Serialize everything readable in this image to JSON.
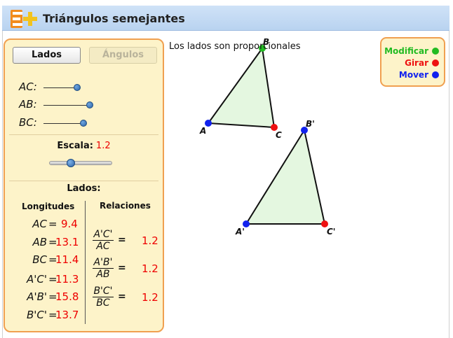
{
  "header": {
    "title": "Triángulos semejantes",
    "logo": "plus-logo-icon"
  },
  "tabs": {
    "lados": "Lados",
    "angulos": "Ángulos"
  },
  "sliders": [
    {
      "label": "AC",
      "value": 9.4
    },
    {
      "label": "AB",
      "value": 13.1
    },
    {
      "label": "BC",
      "value": 11.4
    }
  ],
  "escala": {
    "label": "Escala:",
    "value": "1.2"
  },
  "lados": {
    "title": "Lados:",
    "col_longitudes": "Longitudes",
    "col_relaciones": "Relaciones",
    "longitudes": [
      {
        "name": "AC",
        "value": "9.4"
      },
      {
        "name": "AB",
        "value": "13.1"
      },
      {
        "name": "BC",
        "value": "11.4"
      },
      {
        "name": "A'C'",
        "value": "11.3"
      },
      {
        "name": "A'B'",
        "value": "15.8"
      },
      {
        "name": "B'C'",
        "value": "13.7"
      }
    ],
    "relaciones": [
      {
        "num": "A'C'",
        "den": "AC",
        "value": "1.2"
      },
      {
        "num": "A'B'",
        "den": "AB",
        "value": "1.2"
      },
      {
        "num": "B'C'",
        "den": "BC",
        "value": "1.2"
      }
    ]
  },
  "status": "Los lados son proporcionales",
  "vertex_labels": {
    "A": "A",
    "B": "B",
    "C": "C",
    "A2": "A'",
    "B2": "B'",
    "C2": "C'"
  },
  "legend": [
    {
      "label": "Modificar",
      "color": "#22bb22"
    },
    {
      "label": "Girar",
      "color": "#ee1111"
    },
    {
      "label": "Mover",
      "color": "#1122ee"
    }
  ],
  "colors": {
    "accent": "#f0a050",
    "panel": "#fdf3c9",
    "triangle_fill": "#e4f7e0",
    "value_red": "#ee0000"
  }
}
